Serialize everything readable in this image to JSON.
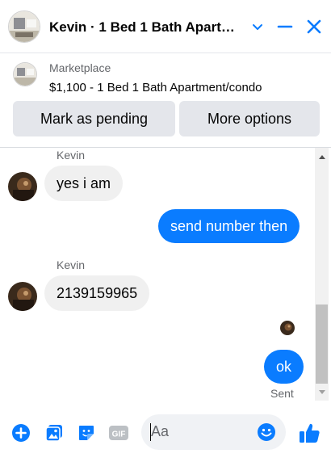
{
  "header": {
    "title": "Kevin · 1 Bed 1 Bath Apart…",
    "icons": [
      "listing-photo",
      "chevron-down-icon",
      "minimize-icon",
      "close-icon"
    ],
    "accent": "#0a7cff"
  },
  "marketplace": {
    "label": "Marketplace",
    "description": "$1,100 - 1 Bed 1 Bath Apartment/condo",
    "mark_pending_label": "Mark as pending",
    "more_options_label": "More options"
  },
  "messages": [
    {
      "direction": "incoming",
      "sender": "Kevin",
      "text": "yes i am"
    },
    {
      "direction": "outgoing",
      "text": "send number then"
    },
    {
      "direction": "incoming",
      "sender": "Kevin",
      "text": "2139159965"
    },
    {
      "direction": "outgoing",
      "text": "ok",
      "status": "Sent"
    }
  ],
  "composer": {
    "placeholder": "Aa",
    "icons": [
      "plus-icon",
      "photo-icon",
      "sticker-icon",
      "gif-icon",
      "emoji-icon",
      "thumbs-up-icon"
    ]
  },
  "colors": {
    "outgoing_bubble": "#0a7cff",
    "incoming_bubble": "#f0f0f0",
    "button_bg": "#e4e6eb",
    "secondary_text": "#65676b"
  }
}
